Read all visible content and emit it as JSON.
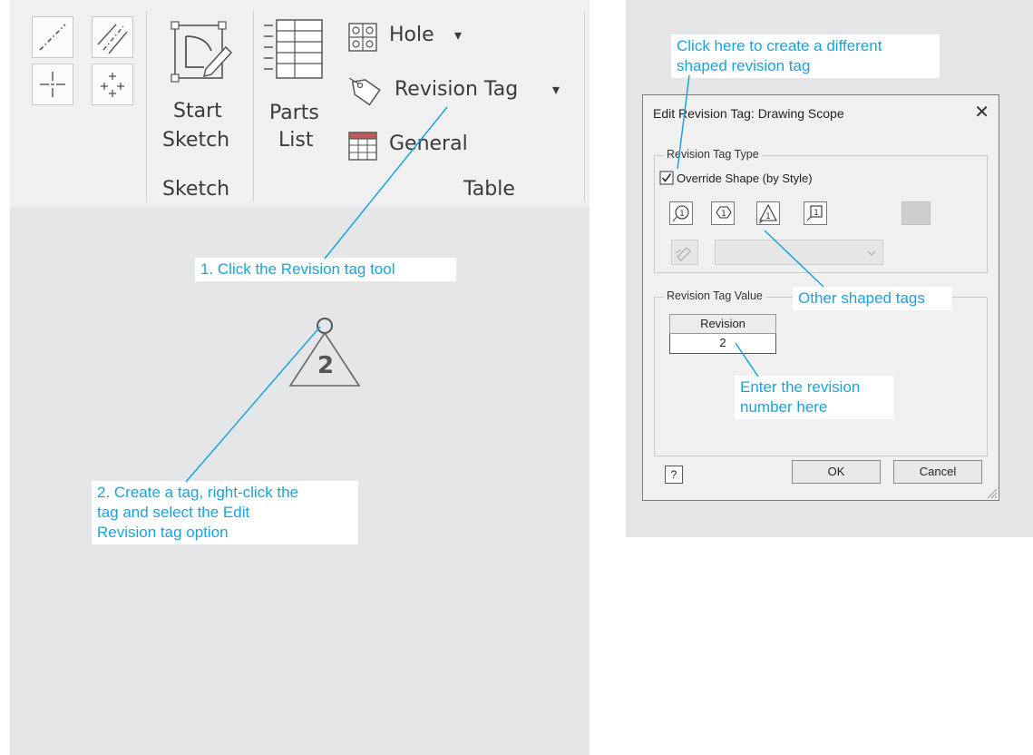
{
  "ribbon": {
    "start_sketch_label_1": "Start",
    "start_sketch_label_2": "Sketch",
    "parts_list_label_1": "Parts",
    "parts_list_label_2": "List",
    "hole_label": "Hole",
    "revision_tag_label": "Revision Tag",
    "general_label": "General",
    "group_sketch": "Sketch",
    "group_table": "Table",
    "dropdown_glyph": "▾"
  },
  "canvas": {
    "tag_value": "2"
  },
  "callouts": {
    "step1": "1. Click the Revision tag tool",
    "step2_line1": "2. Create a tag, right-click the",
    "step2_line2": "tag and select the Edit",
    "step2_line3": "Revision tag option",
    "different_shape_line1": "Click here to create a different",
    "different_shape_line2": "shaped revision tag",
    "other_shapes": "Other shaped tags",
    "enter_number_line1": "Enter the revision",
    "enter_number_line2": "number here"
  },
  "dialog": {
    "title": "Edit Revision Tag: Drawing Scope",
    "close_glyph": "✕",
    "type_group_label": "Revision Tag Type",
    "override_label": "Override Shape (by Style)",
    "override_checked": true,
    "value_group_label": "Revision Tag Value",
    "column_header": "Revision",
    "revision_value": "2",
    "help_glyph": "?",
    "ok_label": "OK",
    "cancel_label": "Cancel"
  },
  "colors": {
    "callout_text": "#1ba3dc",
    "leader_line": "#1ba3dc",
    "panel_bg": "#e5e6e8",
    "ribbon_bg": "#f0f0f0"
  }
}
